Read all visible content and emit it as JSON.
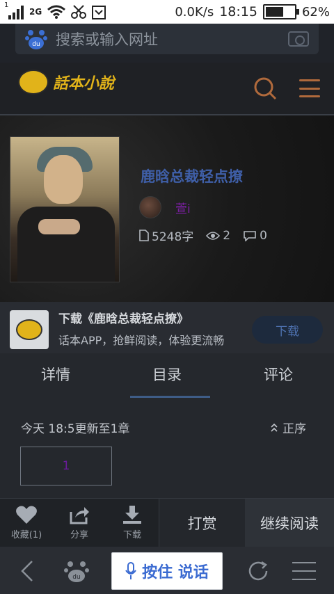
{
  "status_bar": {
    "sim_num": "1",
    "network": "2G",
    "speed": "0.0K/s",
    "time": "18:15",
    "battery_percent": "62%",
    "battery_level": 0.62
  },
  "search": {
    "placeholder": "搜索或输入网址"
  },
  "site": {
    "logo_text": "話本小說"
  },
  "book": {
    "title": "鹿晗总裁轻点撩",
    "author": "萱i",
    "word_count": "5248字",
    "views": "2",
    "comments": "0"
  },
  "download_banner": {
    "title": "下载《鹿晗总裁轻点撩》",
    "subtitle": "话本APP，抢鲜阅读，体验更流畅",
    "button": "下载"
  },
  "tabs": [
    {
      "label": "详情",
      "active": false
    },
    {
      "label": "目录",
      "active": true
    },
    {
      "label": "评论",
      "active": false
    }
  ],
  "catalog": {
    "update_text": "今天 18:5更新至1章",
    "sort_label": "正序",
    "chapters": [
      "1"
    ]
  },
  "actions": {
    "favorite": "收藏(1)",
    "share": "分享",
    "download": "下载",
    "reward": "打赏",
    "continue": "继续阅读"
  },
  "bottom_nav": {
    "voice_label": "按住 说话"
  },
  "colors": {
    "title_blue": "#3f5fa8",
    "author_purple": "#7b1fa2",
    "logo_yellow": "#e1b31a",
    "voice_blue": "#3a6ad1"
  }
}
